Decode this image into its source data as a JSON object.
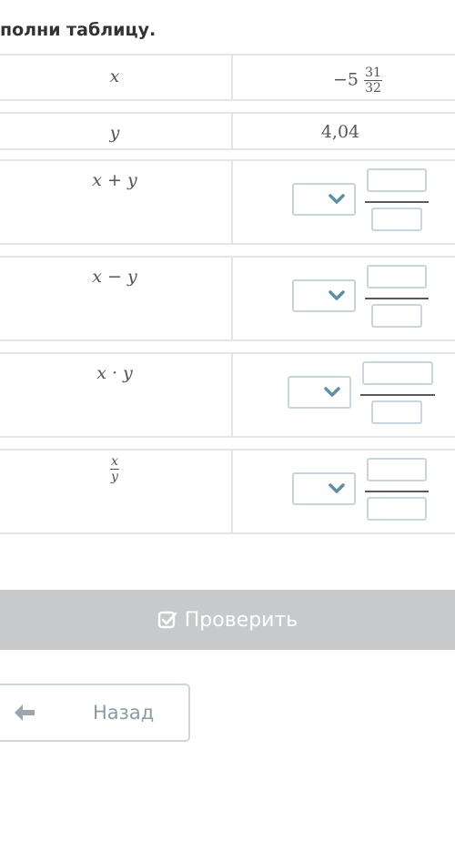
{
  "header": {
    "title": "полни таблицу."
  },
  "table": {
    "rows": [
      {
        "label": "x",
        "value_whole": "−5",
        "value_num": "31",
        "value_den": "32"
      },
      {
        "label": "y",
        "value": "4,04"
      },
      {
        "label": "x + y"
      },
      {
        "label": "x − y"
      },
      {
        "label": "x · y"
      },
      {
        "label_num": "x",
        "label_den": "y"
      }
    ]
  },
  "buttons": {
    "check_label": "Проверить",
    "back_label": "Назад"
  },
  "icons": {
    "dropdown": "chevron-down-icon",
    "check": "checkbox-check-icon",
    "back": "arrow-left-icon"
  },
  "colors": {
    "check_button_bg": "#c7c9cb",
    "input_border": "#c9d5dd",
    "chevron": "#5c8fa6"
  }
}
